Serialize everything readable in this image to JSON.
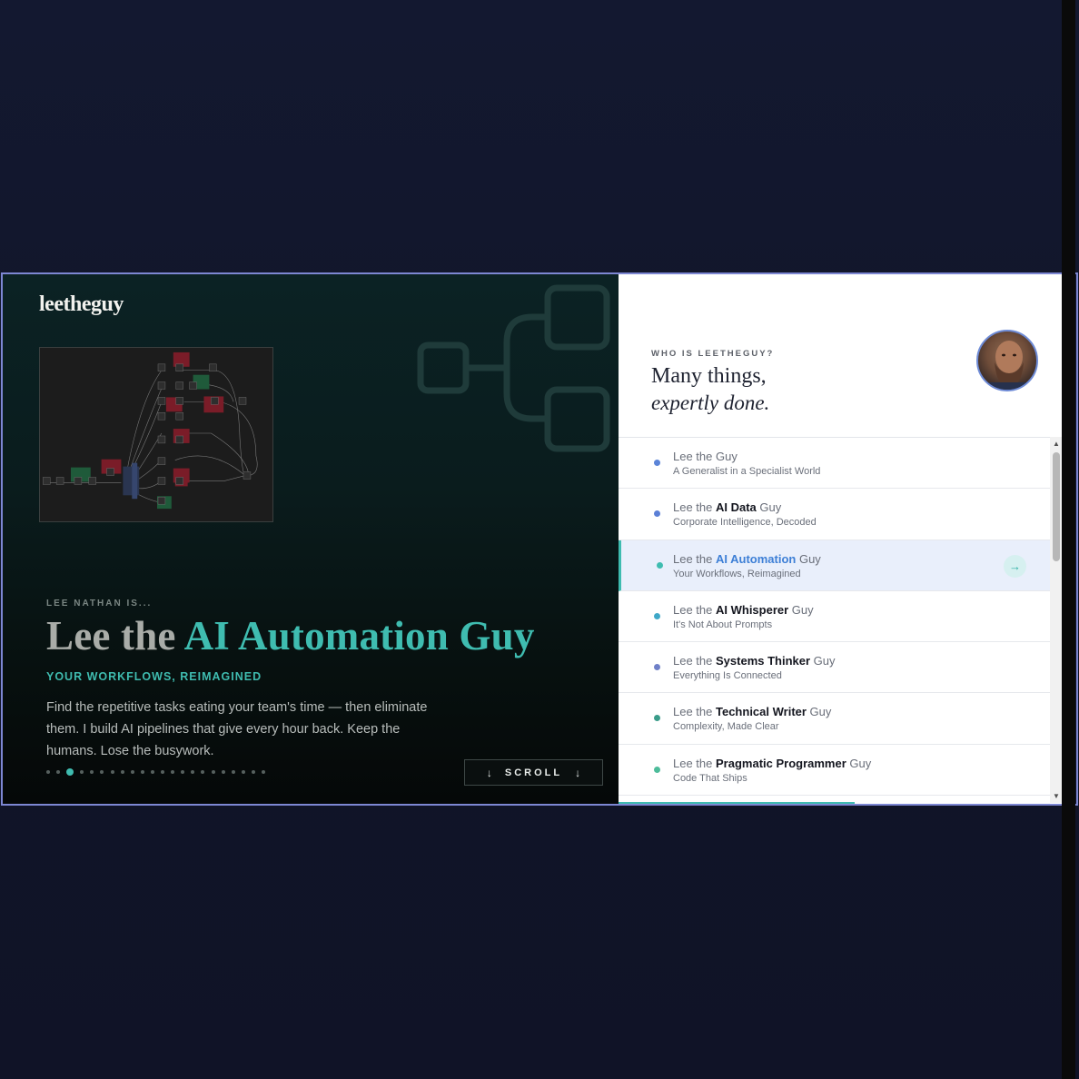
{
  "left": {
    "logo": "leetheguy",
    "eyebrow": "LEE NATHAN IS...",
    "headline_prefix": "Lee the ",
    "headline_accent": "AI Automation Guy",
    "tagline": "YOUR WORKFLOWS, REIMAGINED",
    "description": "Find the repetitive tasks eating your team's time — then eliminate them. I build AI pipelines that give every hour back. Keep the humans. Lose the busywork.",
    "dots": {
      "count": 22,
      "active_index": 2
    },
    "scroll_label": "SCROLL",
    "accent_color": "#3fbcb0"
  },
  "right": {
    "eyebrow": "WHO IS LEETHEGUY?",
    "title_line1": "Many things,",
    "title_line2": "expertly done.",
    "items": [
      {
        "prefix": "Lee the ",
        "bold": "",
        "suffix": "Guy",
        "sub": "A Generalist in a Specialist World",
        "color": "#5b84d8",
        "active": false
      },
      {
        "prefix": "Lee the ",
        "bold": "AI Data",
        "suffix": " Guy",
        "sub": "Corporate Intelligence, Decoded",
        "color": "#5b7fd6",
        "active": false
      },
      {
        "prefix": "Lee the ",
        "bold": "AI Automation",
        "suffix": " Guy",
        "sub": "Your Workflows, Reimagined",
        "color": "#3fbcb0",
        "active": true
      },
      {
        "prefix": "Lee the ",
        "bold": "AI Whisperer",
        "suffix": " Guy",
        "sub": "It's Not About Prompts",
        "color": "#3fa8c8",
        "active": false
      },
      {
        "prefix": "Lee the ",
        "bold": "Systems Thinker",
        "suffix": " Guy",
        "sub": "Everything Is Connected",
        "color": "#6f80c8",
        "active": false
      },
      {
        "prefix": "Lee the ",
        "bold": "Technical Writer",
        "suffix": " Guy",
        "sub": "Complexity, Made Clear",
        "color": "#3a9c8a",
        "active": false
      },
      {
        "prefix": "Lee the ",
        "bold": "Pragmatic Programmer",
        "suffix": " Guy",
        "sub": "Code That Ships",
        "color": "#4dbc9a",
        "active": false
      }
    ]
  }
}
